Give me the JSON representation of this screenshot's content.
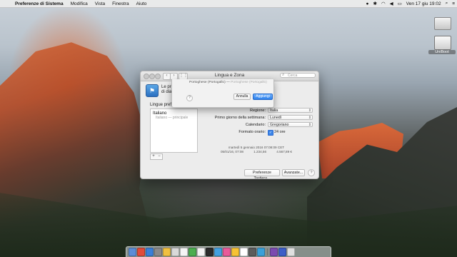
{
  "menubar": {
    "app_name": "Preferenze di Sistema",
    "menus": [
      "Modifica",
      "Vista",
      "Finestra",
      "Aiuto"
    ],
    "datetime": "Ven 17 giu  19:02"
  },
  "desktop": {
    "usb_label": "UniBoot"
  },
  "window": {
    "title": "Lingua e Zona",
    "search_placeholder": "Cerca",
    "description_line1": "Le preferenze",
    "description_line1_end": "re",
    "description_line2": "di dialogo e l",
    "lang_section_title": "Lingue preferite:",
    "languages": [
      {
        "name": "Italiano",
        "sub": "Italiano — principale"
      }
    ],
    "add_remove": [
      "+",
      "−"
    ],
    "form": {
      "region_label": "Regione:",
      "region_value": "Italia",
      "first_day_label": "Primo giorno della settimana:",
      "first_day_value": "Lunedì",
      "calendar_label": "Calendario:",
      "calendar_value": "Gregoriano",
      "time_format_label": "Formato orario:",
      "time_format_value": "24 ore"
    },
    "preview": {
      "line1": "martedì 5 gennaio 2016 07:08:09 CET",
      "line2_left": "05/01/16, 07:08",
      "line2_mid": "1.234,56",
      "line2_right": "4.567,89 €"
    },
    "keyboard_prefs_button": "Preferenze Tastiera...",
    "advanced_button": "Avanzate...",
    "help": "?"
  },
  "sheet": {
    "text_main": "Portoghese (Portogallo) —",
    "text_faint": "Portoghese (Portogallo)",
    "help": "?",
    "cancel": "Annulla",
    "apply": "Aggiungi"
  },
  "dock": {
    "icon_colors": [
      "#5b8dd6",
      "#e14b3a",
      "#3a7fd8",
      "#8a8a8a",
      "#f0c040",
      "#d9d9d9",
      "#f5f5f5",
      "#4cae50",
      "#f4f4f4",
      "#2b2b2b",
      "#43a0e0",
      "#e85b9a",
      "#f7c234",
      "#ffffff",
      "#5c5c5c",
      "#3aa0d8",
      "#7b4bb0",
      "#3c5ec7",
      "#e0e0e0"
    ]
  }
}
